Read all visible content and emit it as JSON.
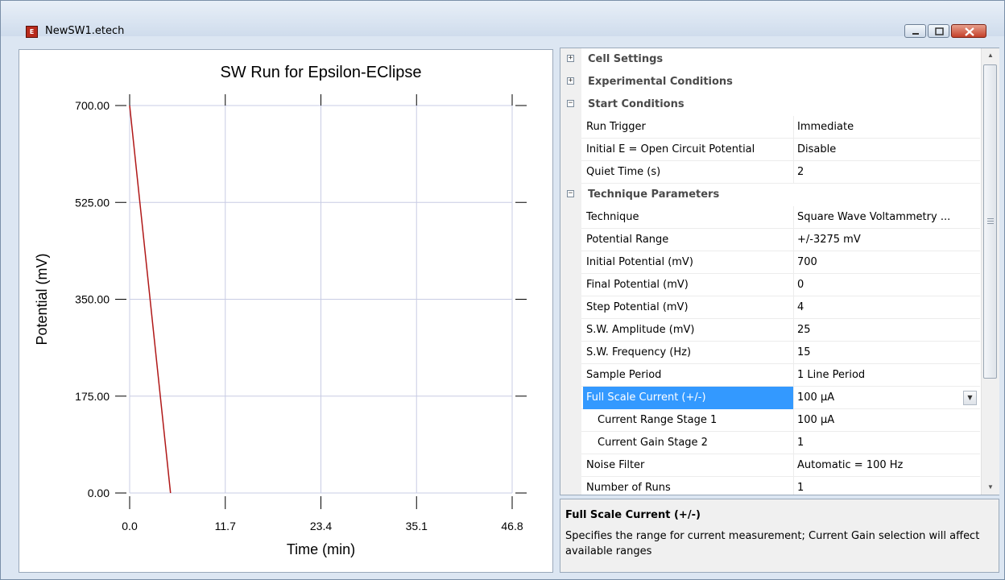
{
  "window": {
    "title": "NewSW1.etech"
  },
  "chart_data": {
    "type": "line",
    "title": "SW Run for Epsilon-EClipse",
    "xlabel": "Time (min)",
    "ylabel": "Potential (mV)",
    "xlim": [
      0,
      46.8
    ],
    "ylim": [
      0,
      700
    ],
    "x_ticks": [
      "0.0",
      "11.7",
      "23.4",
      "35.1",
      "46.8"
    ],
    "y_ticks": [
      "0.00",
      "175.00",
      "350.00",
      "525.00",
      "700.00"
    ],
    "grid": true,
    "series": [
      {
        "x": [
          0,
          5.0
        ],
        "y": [
          700,
          0
        ],
        "color": "#b01818"
      }
    ]
  },
  "properties": {
    "rows": [
      {
        "kind": "category",
        "expander": "⊞",
        "name": "Cell Settings"
      },
      {
        "kind": "category",
        "expander": "⊞",
        "name": "Experimental Conditions"
      },
      {
        "kind": "category",
        "expander": "⊟",
        "name": "Start Conditions"
      },
      {
        "kind": "property",
        "name": "Run Trigger",
        "value": "Immediate"
      },
      {
        "kind": "property",
        "name": "Initial E = Open Circuit Potential",
        "value": "Disable"
      },
      {
        "kind": "property",
        "name": "Quiet Time (s)",
        "value": "2"
      },
      {
        "kind": "category",
        "expander": "⊟",
        "name": "Technique Parameters"
      },
      {
        "kind": "property",
        "name": "Technique",
        "value": "Square Wave Voltammetry ..."
      },
      {
        "kind": "property",
        "name": "Potential Range",
        "value": "+/-3275 mV"
      },
      {
        "kind": "property",
        "name": "Initial Potential (mV)",
        "value": "700"
      },
      {
        "kind": "property",
        "name": "Final Potential (mV)",
        "value": "0"
      },
      {
        "kind": "property",
        "name": "Step Potential (mV)",
        "value": "4"
      },
      {
        "kind": "property",
        "name": "S.W. Amplitude (mV)",
        "value": "25"
      },
      {
        "kind": "property",
        "name": "S.W. Frequency (Hz)",
        "value": "15"
      },
      {
        "kind": "property",
        "name": "Sample Period",
        "value": "1 Line Period"
      },
      {
        "kind": "property",
        "name": "Full Scale Current (+/-)",
        "value": "100 µA",
        "selected": true,
        "dropdown": true
      },
      {
        "kind": "property",
        "name": "Current Range Stage 1",
        "value": "100 µA",
        "indent": true
      },
      {
        "kind": "property",
        "name": "Current Gain Stage 2",
        "value": "1",
        "indent": true
      },
      {
        "kind": "property",
        "name": "Noise Filter",
        "value": "Automatic = 100 Hz"
      },
      {
        "kind": "property",
        "name": "Number of Runs",
        "value": "1"
      }
    ]
  },
  "help": {
    "title": "Full Scale Current (+/-)",
    "description": "Specifies the range for current measurement; Current Gain selection will affect available ranges"
  },
  "icons": {
    "app": "app-icon",
    "minimize": "minimize-icon",
    "maximize": "maximize-icon",
    "close": "close-icon",
    "scroll_up": "▲",
    "scroll_down": "▼",
    "dropdown": "▼"
  }
}
